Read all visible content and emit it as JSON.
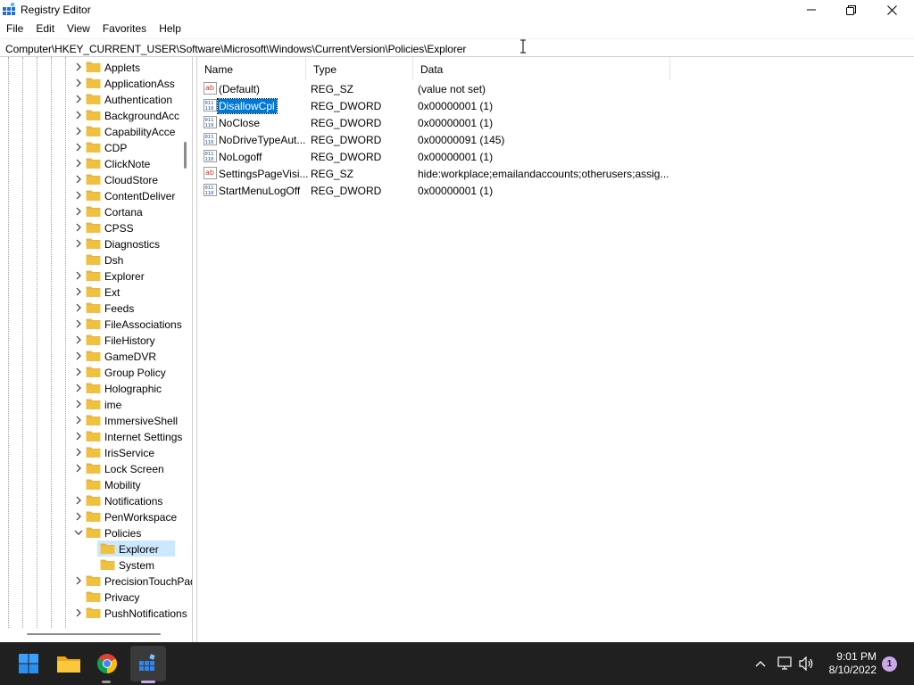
{
  "window": {
    "title": "Registry Editor",
    "controls": [
      "minimize-icon",
      "restore-icon",
      "close-icon"
    ]
  },
  "menu": [
    "File",
    "Edit",
    "View",
    "Favorites",
    "Help"
  ],
  "address": "Computer\\HKEY_CURRENT_USER\\Software\\Microsoft\\Windows\\CurrentVersion\\Policies\\Explorer",
  "tree": {
    "items": [
      {
        "label": "Applets",
        "expandable": true,
        "level": 1
      },
      {
        "label": "ApplicationAss",
        "expandable": true,
        "level": 1
      },
      {
        "label": "Authentication",
        "expandable": true,
        "level": 1
      },
      {
        "label": "BackgroundAcc",
        "expandable": true,
        "level": 1
      },
      {
        "label": "CapabilityAcce",
        "expandable": true,
        "level": 1
      },
      {
        "label": "CDP",
        "expandable": true,
        "level": 1
      },
      {
        "label": "ClickNote",
        "expandable": true,
        "level": 1
      },
      {
        "label": "CloudStore",
        "expandable": true,
        "level": 1
      },
      {
        "label": "ContentDeliver",
        "expandable": true,
        "level": 1
      },
      {
        "label": "Cortana",
        "expandable": true,
        "level": 1
      },
      {
        "label": "CPSS",
        "expandable": true,
        "level": 1
      },
      {
        "label": "Diagnostics",
        "expandable": true,
        "level": 1
      },
      {
        "label": "Dsh",
        "expandable": false,
        "level": 1
      },
      {
        "label": "Explorer",
        "expandable": true,
        "level": 1
      },
      {
        "label": "Ext",
        "expandable": true,
        "level": 1
      },
      {
        "label": "Feeds",
        "expandable": true,
        "level": 1
      },
      {
        "label": "FileAssociations",
        "expandable": true,
        "level": 1
      },
      {
        "label": "FileHistory",
        "expandable": true,
        "level": 1
      },
      {
        "label": "GameDVR",
        "expandable": true,
        "level": 1
      },
      {
        "label": "Group Policy",
        "expandable": true,
        "level": 1
      },
      {
        "label": "Holographic",
        "expandable": true,
        "level": 1
      },
      {
        "label": "ime",
        "expandable": true,
        "level": 1
      },
      {
        "label": "ImmersiveShell",
        "expandable": true,
        "level": 1
      },
      {
        "label": "Internet Settings",
        "expandable": true,
        "level": 1
      },
      {
        "label": "IrisService",
        "expandable": true,
        "level": 1
      },
      {
        "label": "Lock Screen",
        "expandable": true,
        "level": 1
      },
      {
        "label": "Mobility",
        "expandable": false,
        "level": 1
      },
      {
        "label": "Notifications",
        "expandable": true,
        "level": 1
      },
      {
        "label": "PenWorkspace",
        "expandable": true,
        "level": 1
      },
      {
        "label": "Policies",
        "expandable": true,
        "expanded": true,
        "level": 1
      },
      {
        "label": "Explorer",
        "expandable": false,
        "level": 2,
        "selected": true
      },
      {
        "label": "System",
        "expandable": false,
        "level": 2
      },
      {
        "label": "PrecisionTouchPad",
        "expandable": true,
        "level": 1
      },
      {
        "label": "Privacy",
        "expandable": false,
        "level": 1
      },
      {
        "label": "PushNotifications",
        "expandable": true,
        "level": 1
      }
    ]
  },
  "values": {
    "columns": [
      "Name",
      "Type",
      "Data"
    ],
    "rows": [
      {
        "name": "(Default)",
        "type": "REG_SZ",
        "data": "(value not set)",
        "icon": "string-value-icon"
      },
      {
        "name": "DisallowCpl",
        "type": "REG_DWORD",
        "data": "0x00000001 (1)",
        "icon": "binary-value-icon",
        "selected": true
      },
      {
        "name": "NoClose",
        "type": "REG_DWORD",
        "data": "0x00000001 (1)",
        "icon": "binary-value-icon"
      },
      {
        "name": "NoDriveTypeAut...",
        "type": "REG_DWORD",
        "data": "0x00000091 (145)",
        "icon": "binary-value-icon"
      },
      {
        "name": "NoLogoff",
        "type": "REG_DWORD",
        "data": "0x00000001 (1)",
        "icon": "binary-value-icon"
      },
      {
        "name": "SettingsPageVisi...",
        "type": "REG_SZ",
        "data": "hide:workplace;emailandaccounts;otherusers;assig...",
        "icon": "string-value-icon"
      },
      {
        "name": "StartMenuLogOff",
        "type": "REG_DWORD",
        "data": "0x00000001 (1)",
        "icon": "binary-value-icon"
      }
    ]
  },
  "taskbar": {
    "apps": [
      "start-icon",
      "file-explorer-icon",
      "chrome-icon",
      "registry-editor-icon"
    ],
    "tray": [
      "chevron-up-icon",
      "network-icon",
      "volume-icon"
    ],
    "time": "9:01 PM",
    "date": "8/10/2022",
    "notifications": "1"
  },
  "colors": {
    "selection": "#0078d7",
    "tree_selection": "#cce8ff",
    "folder": "#f0c040",
    "taskbar": "#202020"
  }
}
